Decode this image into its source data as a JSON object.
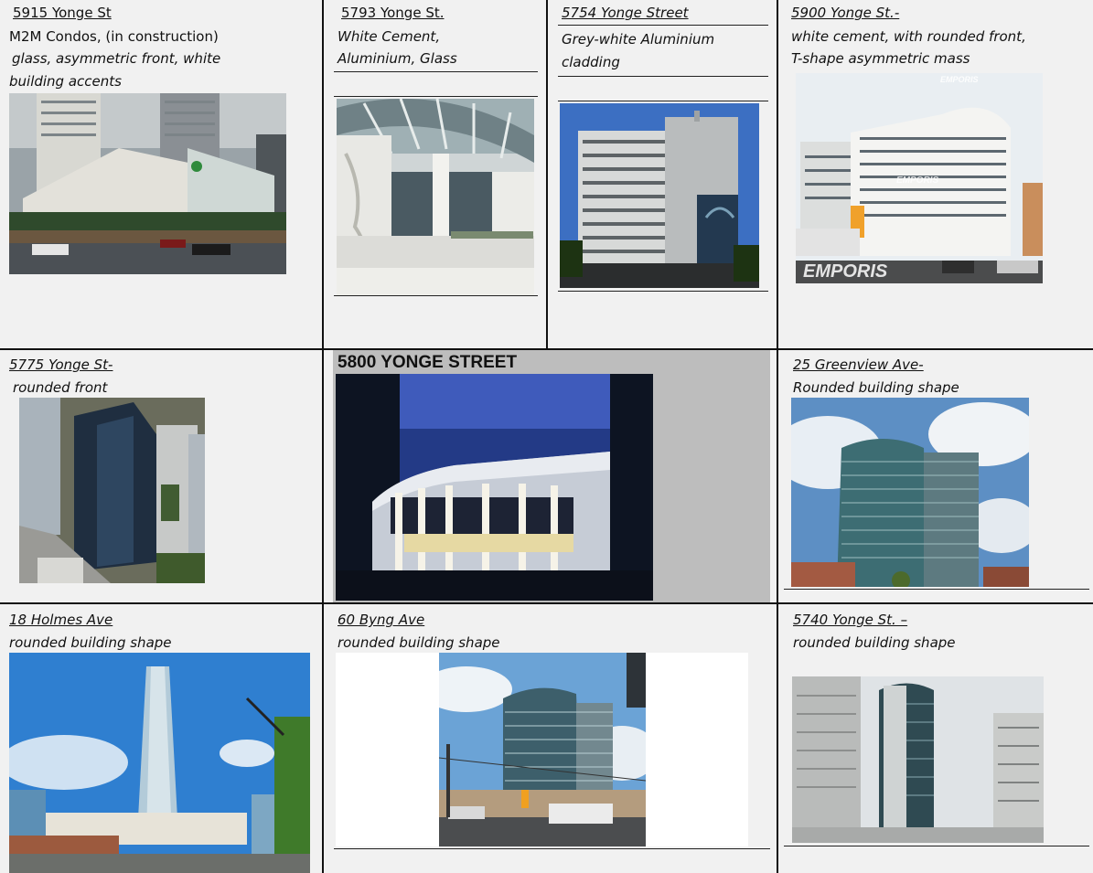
{
  "cells": [
    {
      "address": "5915 Yonge St",
      "lines": [
        "M2M Condos, (in construction)",
        "glass, asymmetric front, white",
        "building accents"
      ],
      "photo": "rendering-of-m2m-condos"
    },
    {
      "address": "5793 Yonge St.",
      "lines": [
        "White Cement,",
        "Aluminium, Glass"
      ],
      "photo": "glass-canopy-entrance"
    },
    {
      "address": "5754 Yonge Street",
      "lines": [
        "Grey-white Aluminium",
        "cladding"
      ],
      "photo": "grey-slab-apartment-tower"
    },
    {
      "address": "5900 Yonge St.-",
      "lines": [
        "white cement, with rounded front,",
        "T-shape asymmetric mass"
      ],
      "photo": "white-curved-apartment-block",
      "watermarks": [
        "EMPORIS",
        "EMPORIS",
        "EMPORIS"
      ]
    },
    {
      "address": "5775 Yonge St-",
      "lines": [
        "rounded front"
      ],
      "photo": "aerial-dark-glass-towers"
    },
    {
      "address": "5800 YONGE STREET",
      "lines": [],
      "photo": "lit-rounded-pavilion-at-night"
    },
    {
      "address": "25 Greenview Ave-",
      "lines": [
        "Rounded building shape"
      ],
      "photo": "curved-glass-tower"
    },
    {
      "address": "18 Holmes Ave",
      "lines": [
        "rounded building shape"
      ],
      "photo": "tall-glass-tower-low-angle"
    },
    {
      "address": "60 Byng Ave",
      "lines": [
        "rounded building shape"
      ],
      "photo": "curved-tower-street-corner"
    },
    {
      "address": "5740 Yonge St. –",
      "lines": [
        "rounded building shape"
      ],
      "photo": "oval-glass-tower-between-slabs"
    }
  ]
}
